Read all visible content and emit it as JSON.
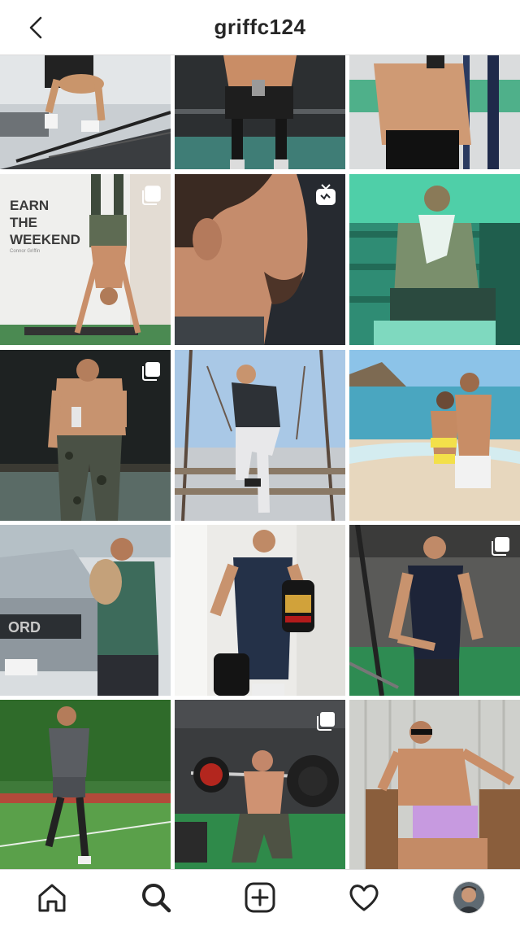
{
  "header": {
    "title": "griffc124",
    "back_icon": "chevron-left-icon"
  },
  "colors": {
    "text": "#262626",
    "border": "#dbdbdb",
    "background": "#ffffff",
    "badge": "#ffffff"
  },
  "posts": [
    {
      "name": "post-jump-bridge",
      "badge": "none"
    },
    {
      "name": "post-gym-standing",
      "badge": "none"
    },
    {
      "name": "post-mirror-selfie",
      "badge": "none"
    },
    {
      "name": "post-handstand-earn-the-weekend",
      "badge": "carousel",
      "text_lines": [
        "EARN",
        "THE",
        "WEEKEND"
      ],
      "subtext": "Connor Griffin"
    },
    {
      "name": "post-profile-closeup",
      "badge": "igtv"
    },
    {
      "name": "post-sauna-towel",
      "badge": "none"
    },
    {
      "name": "post-gym-supplement",
      "badge": "carousel"
    },
    {
      "name": "post-outdoor-knee-raise",
      "badge": "none"
    },
    {
      "name": "post-beach-couple",
      "badge": "none"
    },
    {
      "name": "post-puppy-truck",
      "badge": "none"
    },
    {
      "name": "post-whey-protein",
      "badge": "none"
    },
    {
      "name": "post-home-gym-tank",
      "badge": "carousel"
    },
    {
      "name": "post-track-run",
      "badge": "none"
    },
    {
      "name": "post-barbell-squat",
      "badge": "carousel"
    },
    {
      "name": "post-lounge-sunglasses",
      "badge": "none"
    }
  ],
  "tab_bar": {
    "items": [
      "home-icon",
      "search-icon",
      "new-post-icon",
      "activity-heart-icon",
      "profile-avatar"
    ],
    "active": "search-icon"
  }
}
